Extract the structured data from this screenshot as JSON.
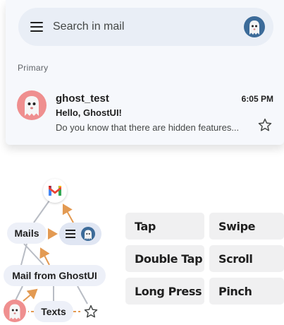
{
  "search": {
    "placeholder": "Search in mail"
  },
  "inbox": {
    "category": "Primary",
    "email": {
      "sender": "ghost_test",
      "time": "6:05 PM",
      "subject": "Hello, GhostUI!",
      "snippet": "Do you know that there are hidden features..."
    }
  },
  "diagram": {
    "mails_label": "Mails",
    "mail_from_label": "Mail from GhostUI",
    "texts_label": "Texts",
    "arrow_color": "#e39a52",
    "line_color": "#b8bcc4"
  },
  "gestures": {
    "tap": "Tap",
    "swipe": "Swipe",
    "double_tap": "Double Tap",
    "scroll": "Scroll",
    "long_press": "Long Press",
    "pinch": "Pinch"
  },
  "colors": {
    "card_background": "#f6f8fc",
    "search_background": "#e9eef6",
    "avatar_pink": "#ef8f8f",
    "avatar_blue": "#3c6b99"
  }
}
